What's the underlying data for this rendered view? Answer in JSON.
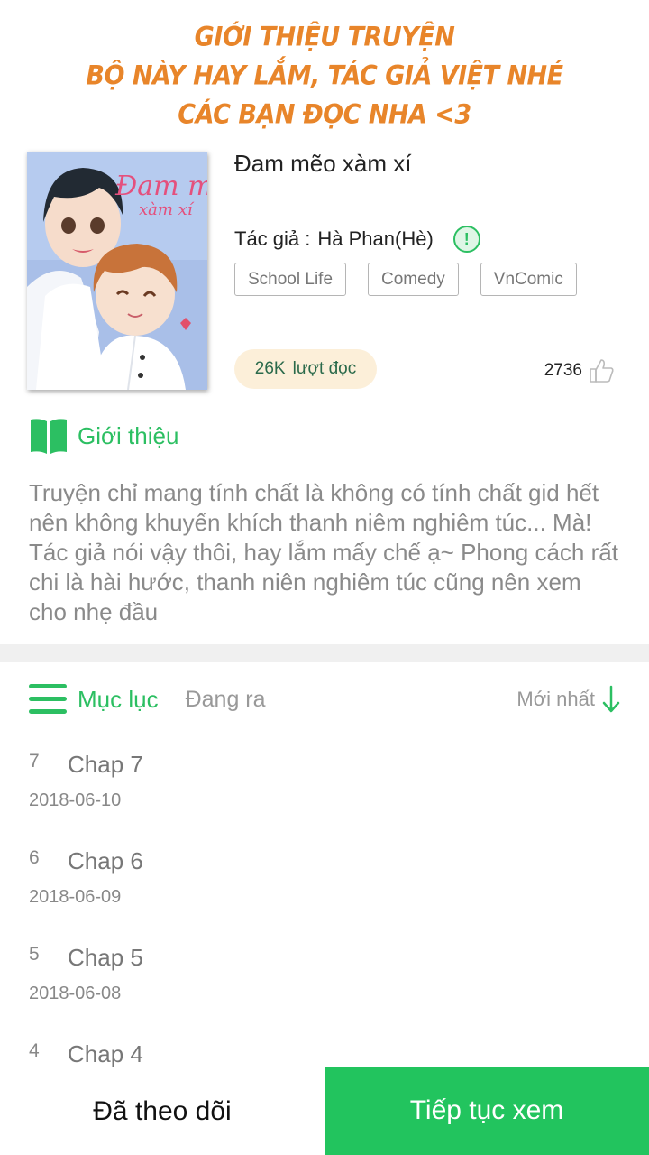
{
  "banner": {
    "line1": "GIỚI THIỆU TRUYỆN",
    "line2": "BỘ NÀY HAY LẮM, TÁC GIẢ VIỆT NHÉ",
    "line3": "CÁC BẠN ĐỌC NHA <3"
  },
  "cover": {
    "title_text": "Đam mê",
    "subtitle_text": "xàm xí"
  },
  "comic": {
    "title": "Đam mẽo xàm xí",
    "author_label": "Tác giả :",
    "author_name": "Hà Phan(Hè)",
    "tags": [
      "School Life",
      "Comedy",
      "VnComic"
    ],
    "reads_count": "26K",
    "reads_label": "lượt đọc",
    "likes": "2736"
  },
  "intro": {
    "label": "Giới thiệu",
    "description": "Truyện chỉ mang tính chất là không có tính chất gid hết nên không khuyến khích thanh niêm nghiêm túc... Mà! Tác giả nói vậy thôi, hay lắm mấy chế ạ~ Phong cách rất chi là hài hước, thanh niên nghiêm túc cũng nên xem cho nhẹ đầu"
  },
  "toc": {
    "label": "Mục lục",
    "status": "Đang ra",
    "sort_label": "Mới nhất",
    "chapters": [
      {
        "num": "7",
        "title": "Chap 7",
        "date": "2018-06-10"
      },
      {
        "num": "6",
        "title": "Chap 6",
        "date": "2018-06-09"
      },
      {
        "num": "5",
        "title": "Chap 5",
        "date": "2018-06-08"
      },
      {
        "num": "4",
        "title": "Chap 4",
        "date": ""
      }
    ]
  },
  "actions": {
    "follow_label": "Đã theo dõi",
    "continue_label": "Tiếp tục xem"
  },
  "colors": {
    "accent": "#22c45e",
    "banner": "#e8852a",
    "reads_bg": "#fcefd9"
  },
  "icons": [
    "info-icon",
    "thumbs-up-icon",
    "book-icon",
    "menu-list-icon",
    "arrow-down-icon"
  ]
}
